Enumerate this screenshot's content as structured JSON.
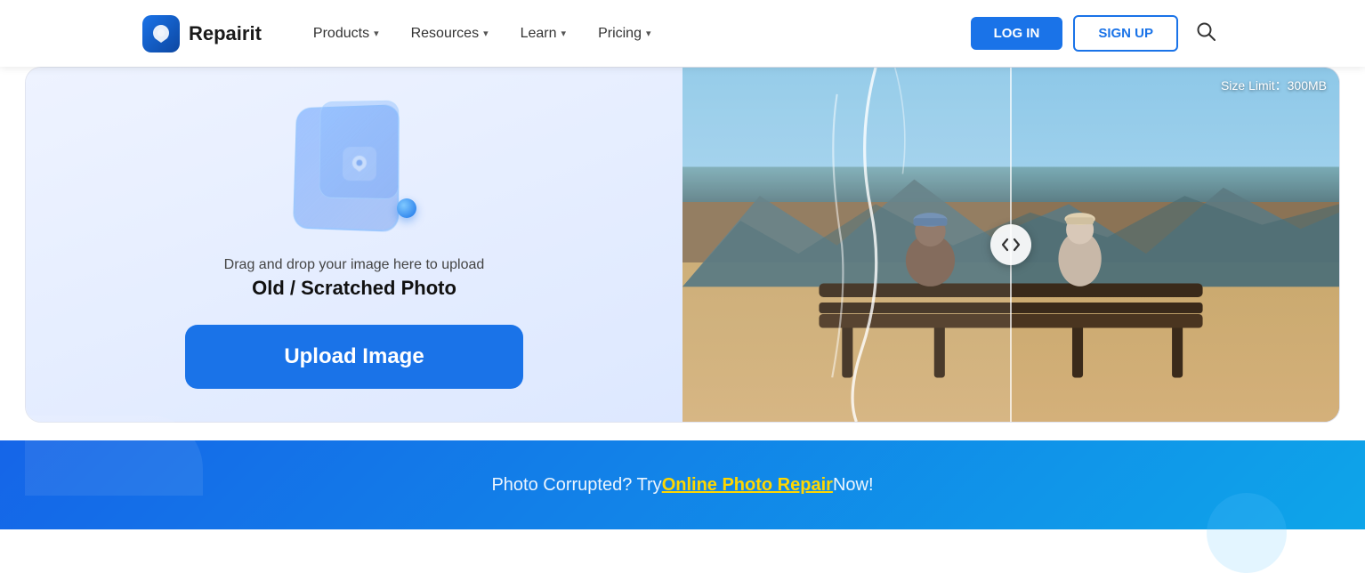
{
  "navbar": {
    "brand_name": "Repairit",
    "nav_items": [
      {
        "label": "Products",
        "has_chevron": true
      },
      {
        "label": "Resources",
        "has_chevron": true
      },
      {
        "label": "Learn",
        "has_chevron": true
      },
      {
        "label": "Pricing",
        "has_chevron": true
      }
    ],
    "login_label": "LOG IN",
    "signup_label": "SIGN UP"
  },
  "upload_panel": {
    "drag_text": "Drag and drop your image here to upload",
    "photo_type": "Old / Scratched Photo",
    "button_label": "Upload Image"
  },
  "preview_panel": {
    "size_limit": "Size Limit：300MB"
  },
  "bottom_banner": {
    "text_before": "Photo Corrupted?  Try ",
    "link_text": "Online Photo Repair",
    "text_after": " Now!"
  }
}
